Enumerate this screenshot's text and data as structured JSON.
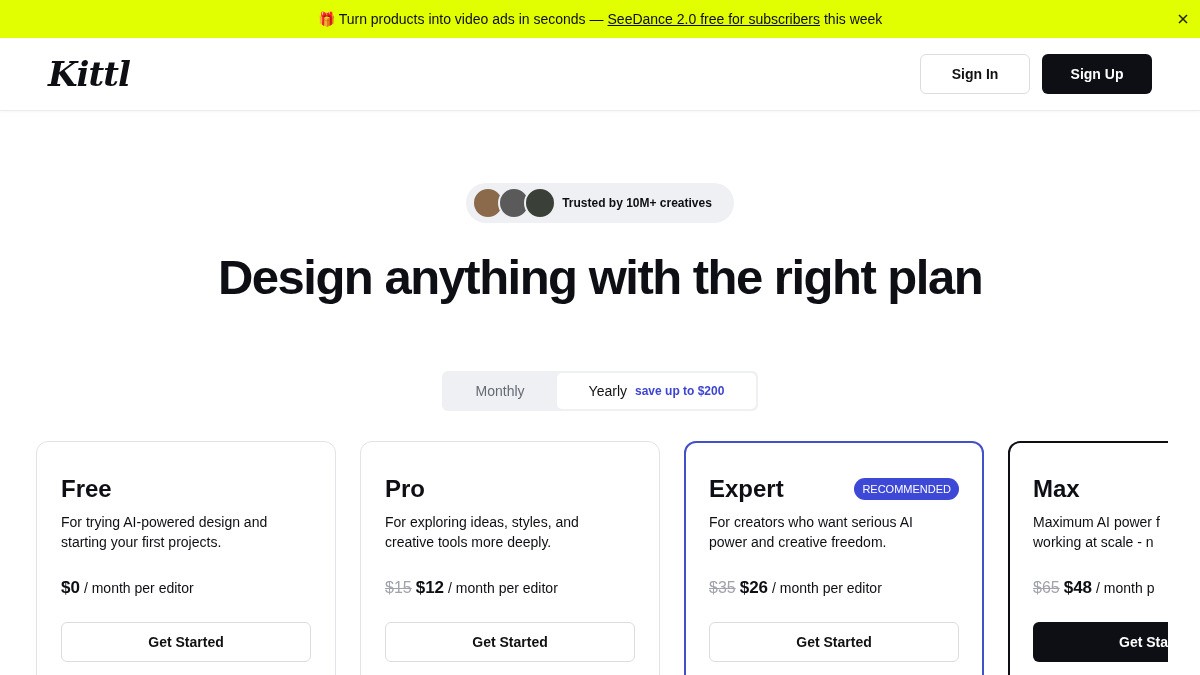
{
  "banner": {
    "icon": "🎁",
    "text": "Turn products into video ads in seconds —",
    "link": "SeeDance 2.0 free for subscribers",
    "suffix": "this week"
  },
  "header": {
    "logo": "Kittl",
    "buttons": [
      {
        "label": "Sign In",
        "primary": false
      },
      {
        "label": "Sign Up",
        "primary": true
      }
    ]
  },
  "trust_badge": {
    "text": "Trusted by 10M+ creatives"
  },
  "heading": "Design anything with the right plan",
  "billing_toggle": [
    {
      "label": "Monthly",
      "selected": false
    },
    {
      "label": "Yearly",
      "selected": true,
      "note": "save up to $200"
    }
  ],
  "plans": [
    {
      "name": "Free",
      "description_lines": [
        "For trying AI-powered design and",
        "starting your first projects."
      ],
      "price": "$0",
      "unit": "/ month per editor",
      "button": "Get Started",
      "primary": false,
      "recommended": false,
      "featured": false,
      "clipped": false
    },
    {
      "name": "Pro",
      "description_lines": [
        "For exploring ideas, styles, and",
        "creative tools more deeply."
      ],
      "old_price": "$15",
      "price": "$12",
      "unit": "/ month per editor",
      "button": "Get Started",
      "primary": false,
      "recommended": false,
      "featured": false,
      "clipped": false
    },
    {
      "name": "Expert",
      "badge": "RECOMMENDED",
      "description_lines": [
        "For creators who want serious AI",
        "power and creative freedom."
      ],
      "old_price": "$35",
      "price": "$26",
      "unit": "/ month per editor",
      "button": "Get Started",
      "primary": false,
      "recommended": true,
      "featured": false,
      "clipped": false
    },
    {
      "name": "Max",
      "description_lines": [
        "Maximum AI power f",
        "working at scale - n"
      ],
      "old_price": "$65",
      "price": "$48",
      "unit": "/ month p",
      "button": "Get Sta",
      "primary": true,
      "recommended": false,
      "featured": true,
      "clipped": true
    }
  ]
}
